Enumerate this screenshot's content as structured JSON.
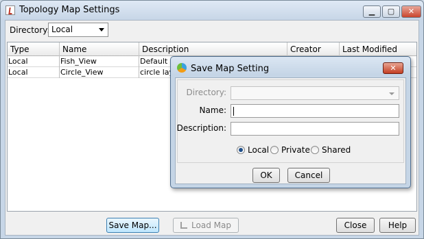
{
  "window": {
    "title": "Topology Map Settings",
    "controls": {
      "minimize": "▁",
      "maximize": "▢",
      "close": "✕"
    }
  },
  "directory": {
    "label": "Directory:",
    "value": "Local"
  },
  "table": {
    "columns": [
      "Type",
      "Name",
      "Description",
      "Creator",
      "Last Modified"
    ],
    "rows": [
      [
        "Local",
        "Fish_View",
        "Default fis",
        "",
        ""
      ],
      [
        "Local",
        "Circle_View",
        "circle layo",
        "",
        ""
      ]
    ]
  },
  "footer": {
    "save_map": "Save Map...",
    "load_map": "Load Map",
    "close": "Close",
    "help": "Help"
  },
  "dialog": {
    "title": "Save Map Setting",
    "close": "✕",
    "directory_label": "Directory:",
    "directory_value": "",
    "name_label": "Name:",
    "name_value": "",
    "description_label": "Description:",
    "description_value": "",
    "radios": [
      {
        "label": "Local",
        "selected": true
      },
      {
        "label": "Private",
        "selected": false
      },
      {
        "label": "Shared",
        "selected": false
      }
    ],
    "ok": "OK",
    "cancel": "Cancel"
  }
}
